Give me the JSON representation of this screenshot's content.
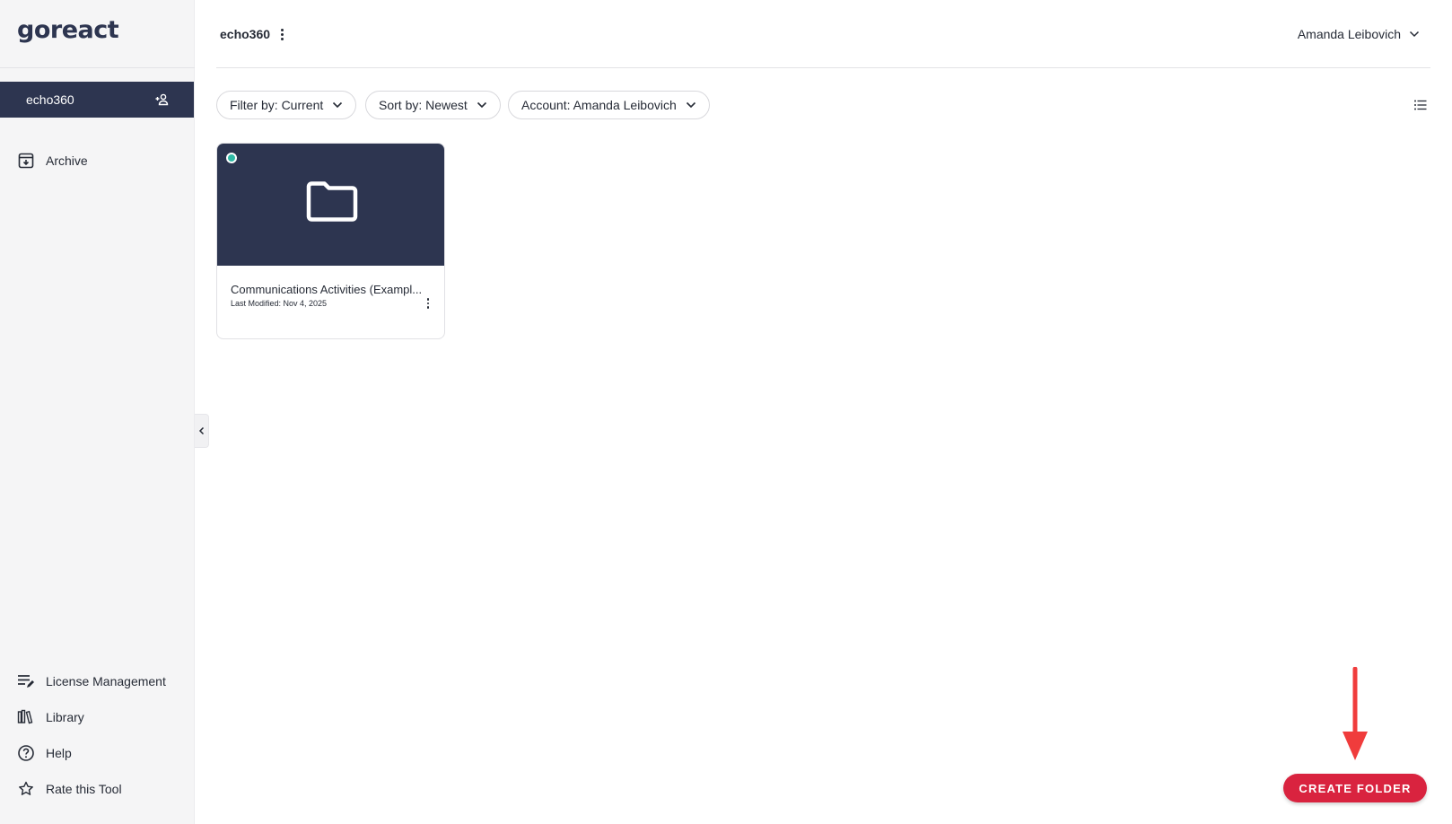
{
  "brand": {
    "logo_text": "goreact"
  },
  "sidebar": {
    "group": {
      "name": "echo360"
    },
    "archive_label": "Archive",
    "bottom_items": [
      {
        "label": "License Management",
        "icon": "license-icon"
      },
      {
        "label": "Library",
        "icon": "library-icon"
      },
      {
        "label": "Help",
        "icon": "help-icon"
      },
      {
        "label": "Rate this Tool",
        "icon": "star-icon"
      }
    ]
  },
  "header": {
    "title": "echo360",
    "user_name": "Amanda Leibovich"
  },
  "filters": {
    "filter_by": "Filter by: Current",
    "sort_by": "Sort by: Newest",
    "account": "Account: Amanda Leibovich"
  },
  "folders": [
    {
      "title": "Communications Activities (Exampl...",
      "last_modified": "Last Modified: Nov 4, 2025"
    }
  ],
  "actions": {
    "create_folder": "CREATE FOLDER"
  },
  "colors": {
    "navy": "#2d3550",
    "accent_red": "#d9233f",
    "status_teal": "#2fb9a5",
    "arrow_red": "#f03c3c"
  }
}
